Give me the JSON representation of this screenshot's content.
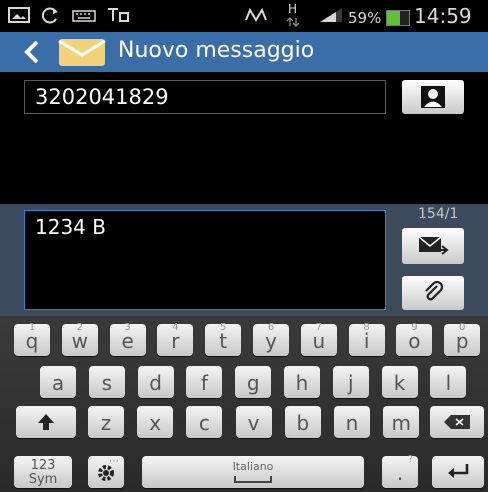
{
  "status_bar": {
    "network_type": "H",
    "battery_percent": "59%",
    "battery_level": 0.59,
    "time": "14:59"
  },
  "action_bar": {
    "title": "Nuovo messaggio"
  },
  "recipient": {
    "value": "3202041829"
  },
  "composer": {
    "message": "1234 B",
    "char_counter": "154/1"
  },
  "keyboard": {
    "row1": [
      {
        "ch": "q",
        "hint": "1"
      },
      {
        "ch": "w",
        "hint": "2"
      },
      {
        "ch": "e",
        "hint": "3"
      },
      {
        "ch": "r",
        "hint": "4"
      },
      {
        "ch": "t",
        "hint": "5"
      },
      {
        "ch": "y",
        "hint": "6"
      },
      {
        "ch": "u",
        "hint": "7"
      },
      {
        "ch": "i",
        "hint": "8"
      },
      {
        "ch": "o",
        "hint": "9"
      },
      {
        "ch": "p",
        "hint": "0"
      }
    ],
    "row2": [
      "a",
      "s",
      "d",
      "f",
      "g",
      "h",
      "j",
      "k",
      "l"
    ],
    "row3": [
      "z",
      "x",
      "c",
      "v",
      "b",
      "n",
      "m"
    ],
    "sym_label_top": "123",
    "sym_label_bottom": "Sym",
    "space_label": "Italiano",
    "period_label": ".",
    "period_hint": "?"
  }
}
